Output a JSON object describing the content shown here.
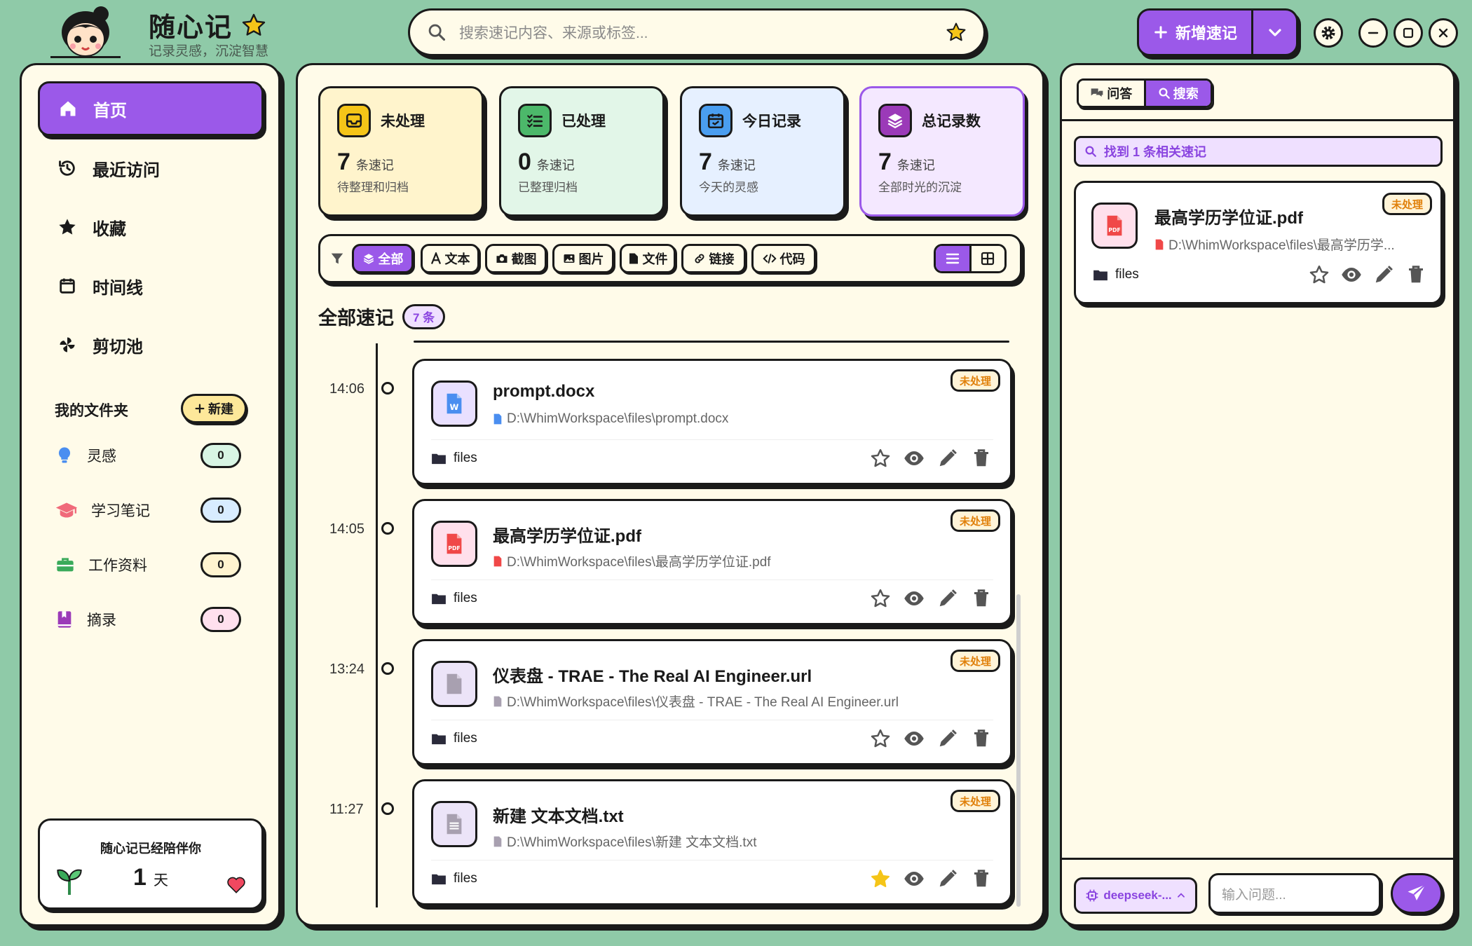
{
  "app": {
    "title": "随心记",
    "subtitle": "记录灵感，沉淀智慧"
  },
  "search": {
    "placeholder": "搜索速记内容、来源或标签..."
  },
  "header": {
    "new_label": "新增速记"
  },
  "nav": {
    "home": "首页",
    "recent": "最近访问",
    "favorites": "收藏",
    "timeline": "时间线",
    "clipboard": "剪切池"
  },
  "folders": {
    "title": "我的文件夹",
    "new_label": "新建",
    "items": [
      {
        "name": "灵感",
        "count": "0",
        "color": "#4a8ef0",
        "bg": "#d8f5e4"
      },
      {
        "name": "学习笔记",
        "count": "0",
        "color": "#f06a7a",
        "bg": "#d8ecff"
      },
      {
        "name": "工作资料",
        "count": "0",
        "color": "#3aaa5a",
        "bg": "#fff4d0"
      },
      {
        "name": "摘录",
        "count": "0",
        "color": "#9b3ab8",
        "bg": "#ffe0ee"
      }
    ]
  },
  "companion": {
    "text": "随心记已经陪伴你",
    "days": "1",
    "unit": "天"
  },
  "stats": [
    {
      "title": "未处理",
      "num": "7",
      "unit": "条速记",
      "sub": "待整理和归档",
      "bg": "#fff4cc",
      "icbg": "#f5c518"
    },
    {
      "title": "已处理",
      "num": "0",
      "unit": "条速记",
      "sub": "已整理归档",
      "bg": "#e2f6e8",
      "icbg": "#4cb86a"
    },
    {
      "title": "今日记录",
      "num": "7",
      "unit": "条速记",
      "sub": "今天的灵感",
      "bg": "#e6f0ff",
      "icbg": "#4a9ef0"
    },
    {
      "title": "总记录数",
      "num": "7",
      "unit": "条速记",
      "sub": "全部时光的沉淀",
      "bg": "#f4e8ff",
      "icbg": "#9b3ab8"
    }
  ],
  "filters": [
    "全部",
    "文本",
    "截图",
    "图片",
    "文件",
    "链接",
    "代码"
  ],
  "list": {
    "title": "全部速记",
    "count": "7 条"
  },
  "status_label": "未处理",
  "notes": [
    {
      "time": "14:06",
      "name": "prompt.docx",
      "path": "D:\\WhimWorkspace\\files\\prompt.docx",
      "folder": "files",
      "type": "word",
      "starred": false
    },
    {
      "time": "14:05",
      "name": "最高学历学位证.pdf",
      "path": "D:\\WhimWorkspace\\files\\最高学历学位证.pdf",
      "folder": "files",
      "type": "pdf",
      "starred": false
    },
    {
      "time": "13:24",
      "name": "仪表盘 - TRAE - The Real AI Engineer.url",
      "path": "D:\\WhimWorkspace\\files\\仪表盘 - TRAE - The Real AI Engineer.url",
      "folder": "files",
      "type": "file",
      "starred": false
    },
    {
      "time": "11:27",
      "name": "新建 文本文档.txt",
      "path": "D:\\WhimWorkspace\\files\\新建 文本文档.txt",
      "folder": "files",
      "type": "txt",
      "starred": true
    }
  ],
  "right": {
    "tabs": [
      "问答",
      "搜索"
    ],
    "found": "找到 1 条相关速记",
    "result": {
      "name": "最高学历学位证.pdf",
      "path": "D:\\WhimWorkspace\\files\\最高学历学...",
      "folder": "files"
    },
    "model": "deepseek-...",
    "ask_placeholder": "输入问题..."
  },
  "colors": {
    "accent": "#9b59e9",
    "bg": "#8fcaa8",
    "panel": "#fffbe9"
  }
}
